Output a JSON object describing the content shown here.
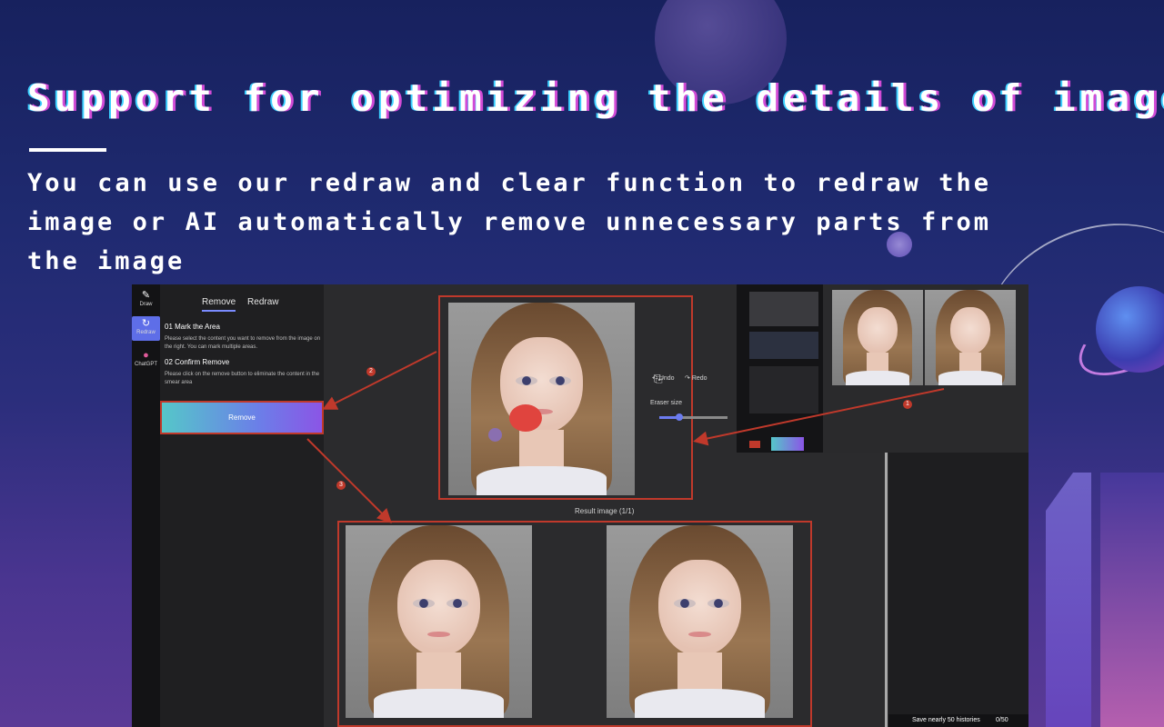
{
  "headline": "Support for optimizing the details of images",
  "subtext": "You can use our redraw and clear function to redraw the image or AI automatically remove unnecessary parts from the image",
  "rail": {
    "items": [
      {
        "label": "Draw",
        "icon": "palette-icon"
      },
      {
        "label": "Redraw",
        "icon": "refresh-icon"
      },
      {
        "label": "ChatGPT",
        "icon": "location-pin-icon"
      }
    ]
  },
  "panel": {
    "tabs": [
      "Remove",
      "Redraw"
    ],
    "step1_title": "01 Mark the Area",
    "step1_desc": "Please select the content you want to remove from the image on the right. You can mark multiple areas.",
    "step2_title": "02 Confirm Remove",
    "step2_desc": "Please click on the remove button to eliminate the content in the smear area",
    "remove_button": "Remove"
  },
  "tools": {
    "undo": "Undo",
    "redo": "Redo",
    "eraser_size": "Eraser size"
  },
  "result_caption": "Result image (1/1)",
  "footer": {
    "histories": "Save nearly 50 histories",
    "count": "0/50"
  },
  "badges": [
    "1",
    "2",
    "3"
  ],
  "colors": {
    "accent": "#6c7cf0",
    "highlight_red": "#c0392b",
    "smear": "#e0443e"
  }
}
